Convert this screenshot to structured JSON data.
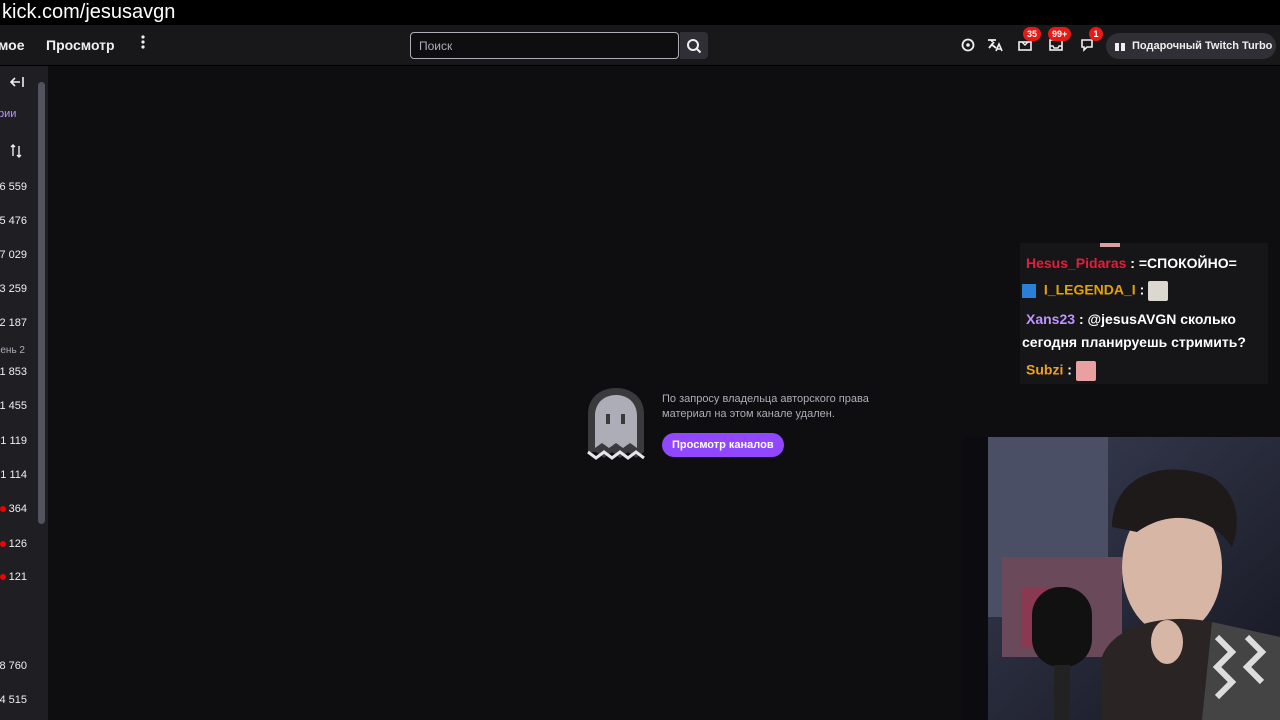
{
  "url_overlay": "kick.com/jesusavgn",
  "nav": {
    "item_following": "мое",
    "item_browse": "Просмотр",
    "search_placeholder": "Поиск",
    "badges": {
      "prime": "35",
      "inbox": "99+",
      "whispers": "1"
    },
    "turbo_label": "Подарочный Twitch Turbo"
  },
  "sidebar": {
    "recs_label": "рии",
    "viewer_counts_a": [
      "6 559",
      "5 476",
      "7 029",
      "3 259",
      "2 187"
    ],
    "section_label": "ень 2",
    "viewer_counts_b": [
      "1 853",
      "1 455",
      "1 119",
      "1 114"
    ],
    "live_counts": [
      "364",
      "126",
      "121"
    ],
    "viewer_counts_c": [
      "8 760",
      "4 515"
    ]
  },
  "notice": {
    "text_line1": "По запросу владельца авторского права",
    "text_line2": "материал на этом канале удален.",
    "button_label": "Просмотр каналов"
  },
  "chat": {
    "messages": [
      {
        "user": "Hesus_Pidaras",
        "color": "#e0203a",
        "text": ": =СПОКОЙНО="
      },
      {
        "user": "I_LEGENDA_I",
        "color": "#e8a200",
        "text": ":"
      },
      {
        "user": "Xans23",
        "color": "#bf94ff",
        "text": ": @jesusAVGN сколько",
        "text2": "сегодня планируешь стримить?"
      },
      {
        "user": "Subzi",
        "color": "#f0a020",
        "text": ":"
      }
    ]
  },
  "colors": {
    "accent": "#9147ff",
    "badge_red": "#e91916",
    "background": "#0e0e10",
    "topnav": "#18181b",
    "sidebar": "#1f1f23"
  }
}
